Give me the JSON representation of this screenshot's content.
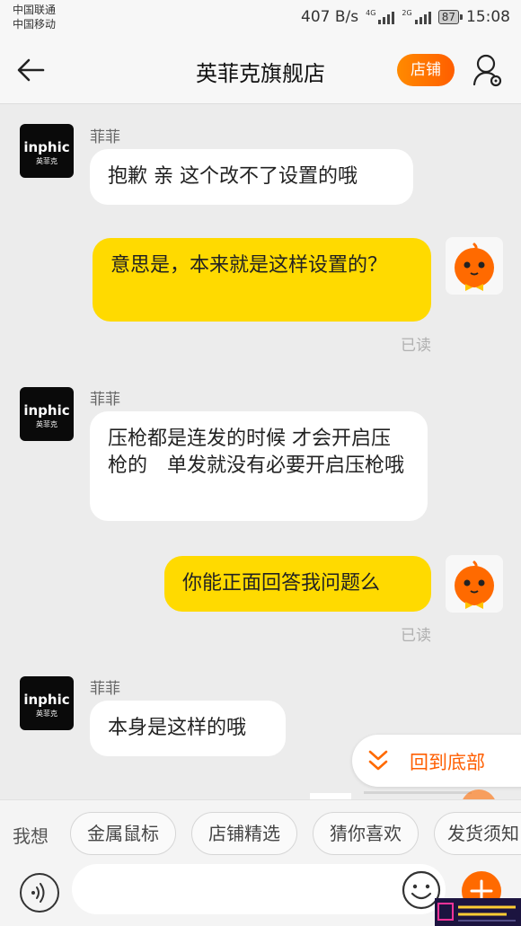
{
  "status_bar": {
    "carrier_1": "中国联通",
    "carrier_2": "中国移动",
    "speed": "407 B/s",
    "network_1": "4G",
    "network_2": "2G",
    "battery": "87",
    "time": "15:08"
  },
  "header": {
    "title": "英菲克旗舰店",
    "store_button": "店铺"
  },
  "store_avatar": {
    "brand": "inphic",
    "brand_sub": "英菲克"
  },
  "messages": [
    {
      "sender": "菲菲",
      "text": "抱歉 亲 这个改不了设置的哦"
    },
    {
      "text": "意思是，本来就是这样设置的？",
      "status": "已读"
    },
    {
      "sender": "菲菲",
      "text": "压枪都是连发的时候 才会开启压枪的　单发就没有必要开启压枪哦"
    },
    {
      "text": "你能正面回答我问题么",
      "status": "已读"
    },
    {
      "sender": "菲菲",
      "text": "本身是这样的哦"
    }
  ],
  "scroll_to_bottom": "回到底部",
  "quick_replies": {
    "label": "我想",
    "items": [
      "金属鼠标",
      "店铺精选",
      "猜你喜欢",
      "发货须知"
    ]
  },
  "input": {
    "placeholder": ""
  },
  "icons": {
    "back": "back-arrow-icon",
    "user_settings": "user-settings-icon",
    "voice": "voice-icon",
    "emoji": "emoji-icon",
    "plus": "plus-icon",
    "chevron": "double-chevron-down-icon"
  },
  "colors": {
    "accent": "#ff6a00",
    "outgoing_bubble": "#ffda00",
    "incoming_bubble": "#ffffff",
    "background": "#ececec"
  }
}
